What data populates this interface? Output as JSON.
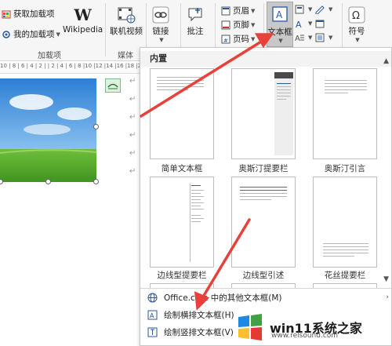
{
  "ribbon": {
    "addins": {
      "get": "获取加载项",
      "mine": "我的加载项",
      "group": "加载项"
    },
    "wikipedia": "Wikipedia",
    "media": {
      "video": "联机视频",
      "group": "媒体"
    },
    "link": "链接",
    "comment": "批注",
    "header": "页眉",
    "footer": "页脚",
    "page_number": "页码",
    "textbox": "文本框",
    "symbol": "符号"
  },
  "ruler_text": "10 | 8 | 6 | 4 | 2 |   | 2 | 4 | 6 | 8 |10 |12 |14 |16 |18 |20 |22 |24 |26 |28",
  "panel": {
    "section": "内置",
    "thumbs": [
      {
        "label": "简单文本框"
      },
      {
        "label": "奥斯汀提要栏"
      },
      {
        "label": "奥斯汀引言"
      },
      {
        "label": "边线型提要栏"
      },
      {
        "label": "边线型引述"
      },
      {
        "label": "花丝提要栏"
      }
    ],
    "menu": {
      "office_more": "Office.com 中的其他文本框(M)",
      "draw_horizontal": "绘制横排文本框(H)",
      "draw_vertical": "绘制竖排文本框(V)"
    }
  },
  "watermark": {
    "text": "win11系统之家",
    "sub": "www.relsound.com"
  },
  "colors": {
    "accent": "#2b579a",
    "arrow": "#e8403a",
    "selected_bg": "#c8c8c8"
  }
}
